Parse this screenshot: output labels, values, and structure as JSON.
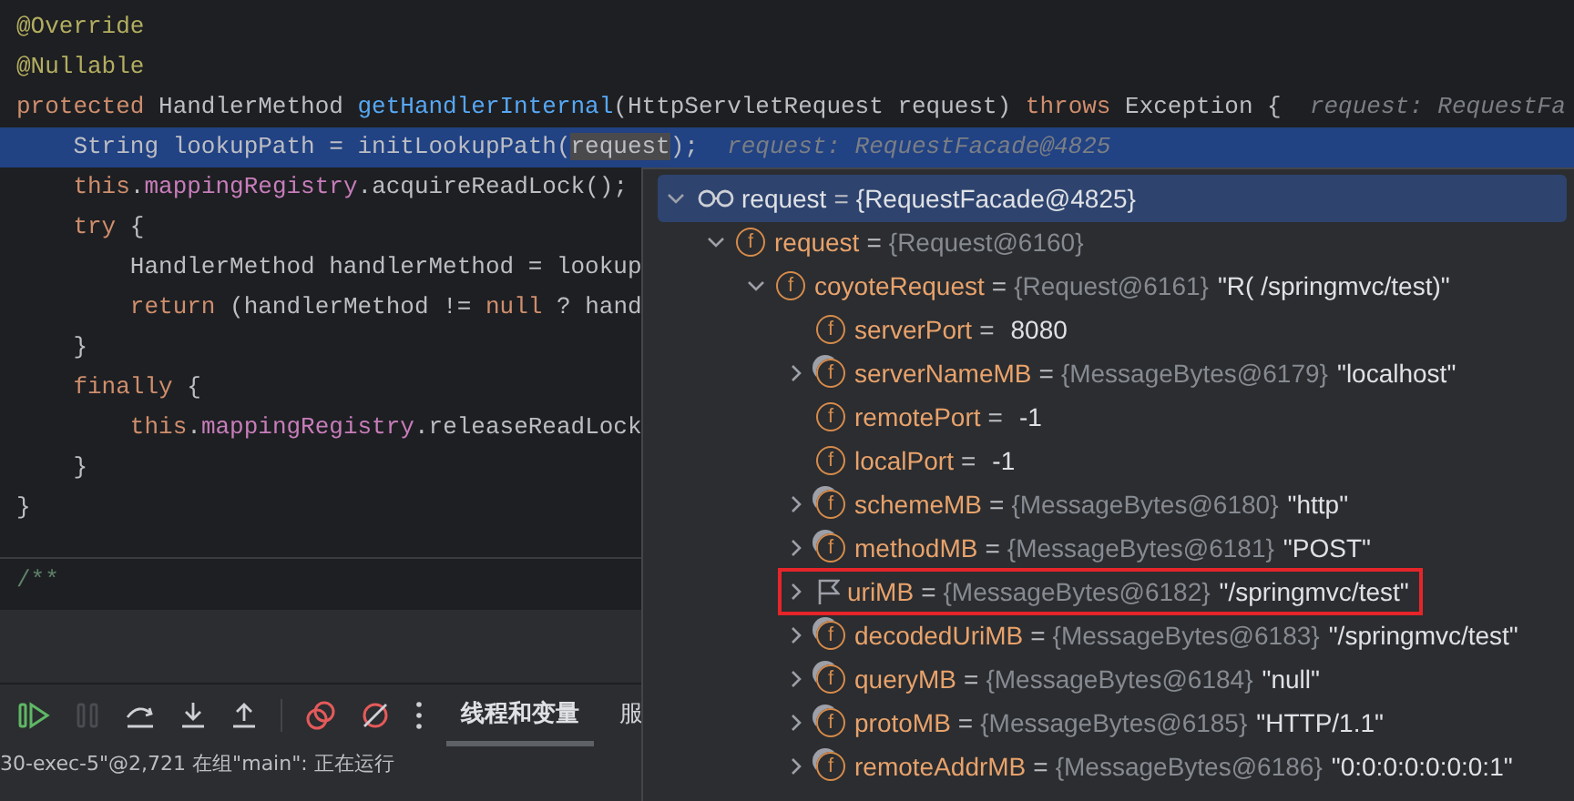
{
  "code_lines": [
    {
      "current": false,
      "tokens": [
        {
          "kind": "annotation",
          "text": "@Override"
        }
      ]
    },
    {
      "current": false,
      "tokens": [
        {
          "kind": "annotation",
          "text": "@Nullable"
        }
      ]
    },
    {
      "current": false,
      "tokens": [
        {
          "kind": "keyword",
          "text": "protected "
        },
        {
          "kind": "plain",
          "text": "HandlerMethod "
        },
        {
          "kind": "method",
          "text": "getHandlerInternal"
        },
        {
          "kind": "plain",
          "text": "(HttpServletRequest request) "
        },
        {
          "kind": "keyword",
          "text": "throws "
        },
        {
          "kind": "plain",
          "text": "Exception {  "
        },
        {
          "kind": "hint",
          "text": "request: RequestFa"
        }
      ]
    },
    {
      "current": true,
      "tokens": [
        {
          "kind": "plain",
          "text": "    String lookupPath = initLookupPath("
        },
        {
          "kind": "usage",
          "text": "request"
        },
        {
          "kind": "plain",
          "text": ");  "
        },
        {
          "kind": "hint",
          "text": "request: RequestFacade@4825"
        }
      ]
    },
    {
      "current": false,
      "tokens": [
        {
          "kind": "keyword",
          "text": "    this"
        },
        {
          "kind": "plain",
          "text": "."
        },
        {
          "kind": "field",
          "text": "mappingRegistry"
        },
        {
          "kind": "plain",
          "text": ".acquireReadLock();"
        }
      ]
    },
    {
      "current": false,
      "tokens": [
        {
          "kind": "keyword",
          "text": "    try "
        },
        {
          "kind": "plain",
          "text": "{"
        }
      ]
    },
    {
      "current": false,
      "tokens": [
        {
          "kind": "plain",
          "text": "        HandlerMethod handlerMethod = lookup"
        }
      ]
    },
    {
      "current": false,
      "tokens": [
        {
          "kind": "keyword",
          "text": "        return "
        },
        {
          "kind": "plain",
          "text": "(handlerMethod != "
        },
        {
          "kind": "keyword",
          "text": "null "
        },
        {
          "kind": "plain",
          "text": "? hand"
        }
      ]
    },
    {
      "current": false,
      "tokens": [
        {
          "kind": "plain",
          "text": "    }"
        }
      ]
    },
    {
      "current": false,
      "tokens": [
        {
          "kind": "keyword",
          "text": "    finally "
        },
        {
          "kind": "plain",
          "text": "{"
        }
      ]
    },
    {
      "current": false,
      "tokens": [
        {
          "kind": "keyword",
          "text": "        this"
        },
        {
          "kind": "plain",
          "text": "."
        },
        {
          "kind": "field",
          "text": "mappingRegistry"
        },
        {
          "kind": "plain",
          "text": ".releaseReadLock"
        }
      ]
    },
    {
      "current": false,
      "tokens": [
        {
          "kind": "plain",
          "text": "    }"
        }
      ]
    },
    {
      "current": false,
      "tokens": [
        {
          "kind": "plain",
          "text": "}"
        }
      ]
    }
  ],
  "doc_comment": "/**",
  "toolbar": [
    {
      "kind": "resume",
      "disabled": false
    },
    {
      "kind": "pause",
      "disabled": true
    },
    {
      "kind": "step-over",
      "disabled": false
    },
    {
      "kind": "step-into",
      "disabled": false
    },
    {
      "kind": "step-out",
      "disabled": false
    },
    {
      "kind": "breakpoints",
      "disabled": false
    },
    {
      "kind": "mute",
      "disabled": false
    },
    {
      "kind": "more",
      "disabled": false
    }
  ],
  "tabs": [
    {
      "label": "线程和变量",
      "selected": true
    },
    {
      "label": "服",
      "selected": false
    }
  ],
  "status_bar": "30-exec-5\"@2,721 在组\"main\": 正在运行",
  "variables": [
    {
      "kind": "watch",
      "name": "request",
      "op": "=",
      "ref": "{RequestFacade@4825}",
      "expanded": true,
      "selected": true,
      "boxed": false,
      "children": [
        {
          "kind": "field",
          "badge": "f",
          "name": "request",
          "op": "=",
          "ref": "{Request@6160}",
          "expanded": true,
          "selected": false,
          "boxed": false,
          "children": [
            {
              "kind": "field",
              "badge": "f",
              "name": "coyoteRequest",
              "op": "=",
              "ref": "{Request@6161}",
              "value": "\"R( /springmvc/test)\"",
              "expanded": true,
              "selected": false,
              "boxed": false,
              "children": [
                {
                  "kind": "field",
                  "badge": "f",
                  "name": "serverPort",
                  "op": "=",
                  "value": "8080",
                  "selected": false,
                  "boxed": false
                },
                {
                  "kind": "field-marked",
                  "badge": "f",
                  "name": "serverNameMB",
                  "op": "=",
                  "ref": "{MessageBytes@6179}",
                  "value": "\"localhost\"",
                  "expanded": false,
                  "selected": false,
                  "boxed": false
                },
                {
                  "kind": "field",
                  "badge": "f",
                  "name": "remotePort",
                  "op": "=",
                  "value": "-1",
                  "selected": false,
                  "boxed": false
                },
                {
                  "kind": "field",
                  "badge": "f",
                  "name": "localPort",
                  "op": "=",
                  "value": "-1",
                  "selected": false,
                  "boxed": false
                },
                {
                  "kind": "field-marked",
                  "badge": "f",
                  "name": "schemeMB",
                  "op": "=",
                  "ref": "{MessageBytes@6180}",
                  "value": "\"http\"",
                  "expanded": false,
                  "selected": false,
                  "boxed": false
                },
                {
                  "kind": "field-marked",
                  "badge": "f",
                  "name": "methodMB",
                  "op": "=",
                  "ref": "{MessageBytes@6181}",
                  "value": "\"POST\"",
                  "expanded": false,
                  "selected": false,
                  "boxed": false
                },
                {
                  "kind": "flag",
                  "name": "uriMB",
                  "op": "=",
                  "ref": "{MessageBytes@6182}",
                  "value": "\"/springmvc/test\"",
                  "expanded": false,
                  "selected": false,
                  "boxed": true
                },
                {
                  "kind": "field-marked",
                  "badge": "f",
                  "name": "decodedUriMB",
                  "op": "=",
                  "ref": "{MessageBytes@6183}",
                  "value": "\"/springmvc/test\"",
                  "expanded": false,
                  "selected": false,
                  "boxed": false
                },
                {
                  "kind": "field-marked",
                  "badge": "f",
                  "name": "queryMB",
                  "op": "=",
                  "ref": "{MessageBytes@6184}",
                  "value": "\"null\"",
                  "expanded": false,
                  "selected": false,
                  "boxed": false
                },
                {
                  "kind": "field-marked",
                  "badge": "f",
                  "name": "protoMB",
                  "op": "=",
                  "ref": "{MessageBytes@6185}",
                  "value": "\"HTTP/1.1\"",
                  "expanded": false,
                  "selected": false,
                  "boxed": false
                },
                {
                  "kind": "field-marked",
                  "badge": "f",
                  "name": "remoteAddrMB",
                  "op": "=",
                  "ref": "{MessageBytes@6186}",
                  "value": "\"0:0:0:0:0:0:0:1\"",
                  "expanded": false,
                  "selected": false,
                  "boxed": false
                }
              ]
            }
          ]
        }
      ]
    }
  ]
}
